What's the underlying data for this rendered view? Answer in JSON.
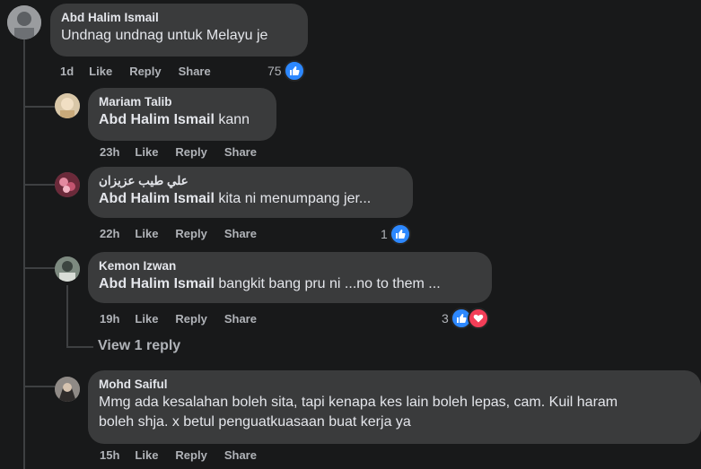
{
  "comments": [
    {
      "author": "Abd Halim Ismail",
      "mention": "",
      "text": "Undnag undnag untuk Melayu je",
      "time": "1d",
      "reaction_count": "75",
      "reactions": [
        "like-icon"
      ]
    },
    {
      "author": "Mariam Talib",
      "mention": "Abd Halim Ismail",
      "text": "kann",
      "time": "23h",
      "reaction_count": "",
      "reactions": []
    },
    {
      "author": "علي طيب عزيزان",
      "mention": "Abd Halim Ismail",
      "text": "kita ni menumpang jer...",
      "time": "22h",
      "reaction_count": "1",
      "reactions": [
        "like-icon"
      ]
    },
    {
      "author": "Kemon Izwan",
      "mention": "Abd Halim Ismail",
      "text": "bangkit bang pru ni ...no to them ...",
      "time": "19h",
      "reaction_count": "3",
      "reactions": [
        "like-icon",
        "love-icon"
      ]
    },
    {
      "author": "Mohd Saiful",
      "mention": "",
      "text_line1": "Mmg ada kesalahan boleh sita, tapi kenapa kes lain boleh lepas, cam. Kuil haram",
      "text_line2": "boleh shja. x betul penguatkuasaan buat kerja ya",
      "time": "15h",
      "reaction_count": "",
      "reactions": []
    }
  ],
  "actions": {
    "like": "Like",
    "reply": "Reply",
    "share": "Share"
  },
  "view_replies": "View 1 reply",
  "colors": {
    "background": "#18191a",
    "bubble": "#3a3b3c",
    "like": "#2d88ff",
    "love": "#f33e58",
    "muted": "#b0b3b8"
  }
}
